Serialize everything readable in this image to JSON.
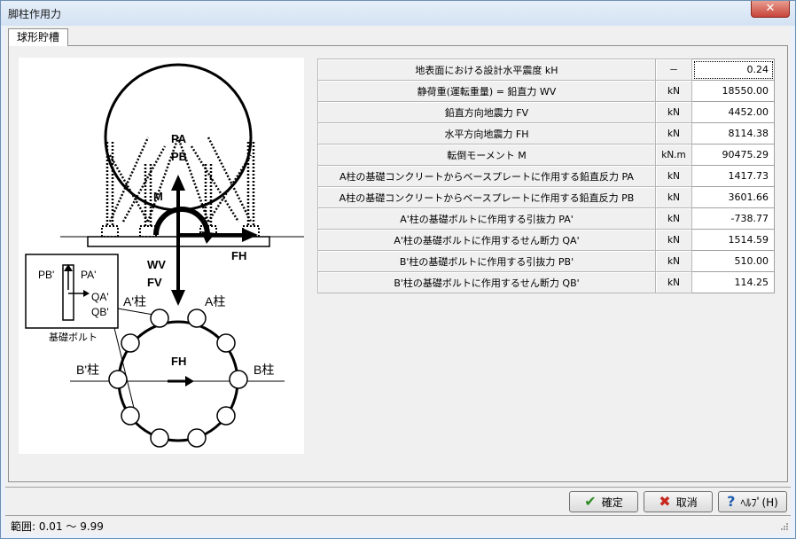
{
  "window": {
    "title": "脚柱作用力"
  },
  "tab": {
    "label": "球形貯槽"
  },
  "diagram": {
    "PA": "PA",
    "PB": "PB",
    "M": "M",
    "WV": "WV",
    "FV": "FV",
    "FH_top": "FH",
    "PB_prime": "PB'",
    "PA_prime": "PA'",
    "QA_prime": "QA'",
    "QB_prime": "QB'",
    "bolt_label": "基礎ボルト",
    "A_prime_col": "A'柱",
    "A_col": "A柱",
    "B_prime_col": "B'柱",
    "B_col": "B柱",
    "FH_bottom": "FH"
  },
  "rows": [
    {
      "label": "地表面における設計水平震度 kH",
      "unit": "－",
      "value": "0.24"
    },
    {
      "label": "静荷重(運転重量) = 鉛直力 WV",
      "unit": "kN",
      "value": "18550.00"
    },
    {
      "label": "鉛直方向地震力 FV",
      "unit": "kN",
      "value": "4452.00"
    },
    {
      "label": "水平方向地震力 FH",
      "unit": "kN",
      "value": "8114.38"
    },
    {
      "label": "転倒モーメント M",
      "unit": "kN.m",
      "value": "90475.29"
    },
    {
      "label": "A柱の基礎コンクリートからベースプレートに作用する鉛直反力 PA",
      "unit": "kN",
      "value": "1417.73"
    },
    {
      "label": "A柱の基礎コンクリートからベースプレートに作用する鉛直反力 PB",
      "unit": "kN",
      "value": "3601.66"
    },
    {
      "label": "A'柱の基礎ボルトに作用する引抜力 PA'",
      "unit": "kN",
      "value": "-738.77"
    },
    {
      "label": "A'柱の基礎ボルトに作用するせん断力 QA'",
      "unit": "kN",
      "value": "1514.59"
    },
    {
      "label": "B'柱の基礎ボルトに作用する引抜力 PB'",
      "unit": "kN",
      "value": "510.00"
    },
    {
      "label": "B'柱の基礎ボルトに作用するせん断力 QB'",
      "unit": "kN",
      "value": "114.25"
    }
  ],
  "buttons": {
    "ok": "確定",
    "cancel": "取消",
    "help": "ﾍﾙﾌﾟ(H)"
  },
  "status": {
    "text": "範囲: 0.01 ～ 9.99"
  },
  "colors": {
    "ok_icon": "#2e8b24",
    "cancel_icon": "#c8281e",
    "help_icon": "#1f5fb0"
  }
}
